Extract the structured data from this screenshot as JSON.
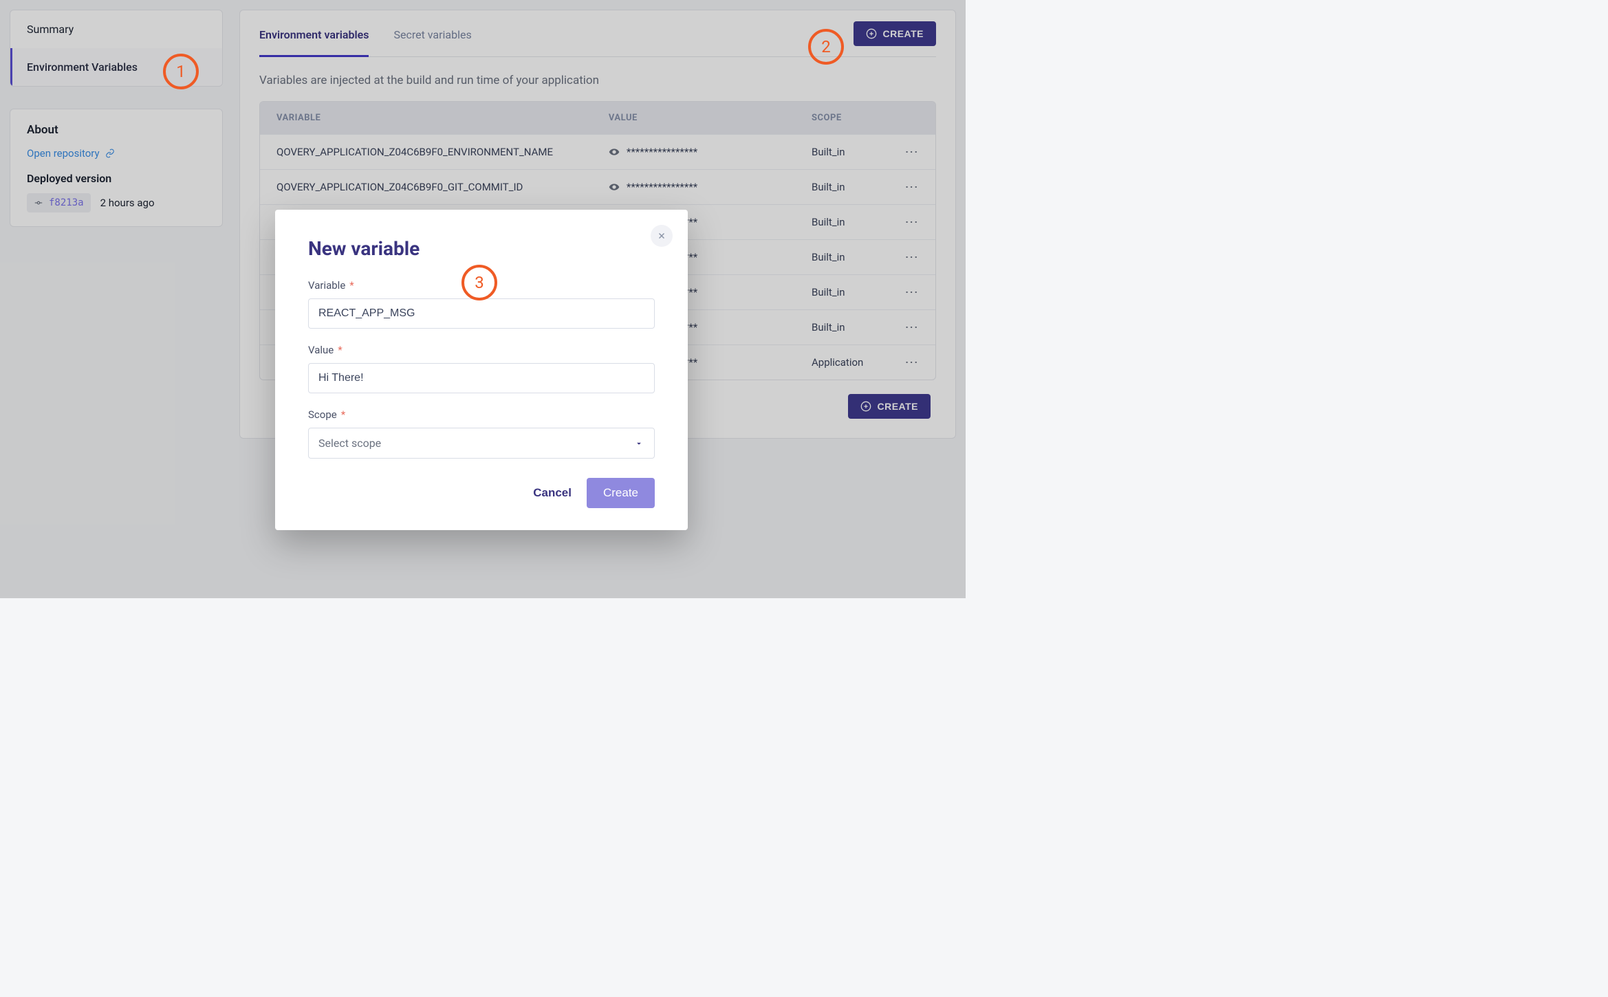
{
  "sidebar": {
    "nav": [
      {
        "label": "Summary"
      },
      {
        "label": "Environment Variables"
      }
    ],
    "about": {
      "title": "About",
      "open_repo": "Open repository",
      "deployed_title": "Deployed version",
      "commit_hash": "f8213a",
      "commit_ago": "2 hours ago"
    }
  },
  "main": {
    "tabs": [
      {
        "label": "Environment variables"
      },
      {
        "label": "Secret variables"
      }
    ],
    "create_label": "CREATE",
    "description": "Variables are injected at the build and run time of your application",
    "columns": {
      "variable": "VARIABLE",
      "value": "VALUE",
      "scope": "SCOPE"
    },
    "masked_value": "****************",
    "rows": [
      {
        "name": "QOVERY_APPLICATION_Z04C6B9F0_ENVIRONMENT_NAME",
        "scope": "Built_in"
      },
      {
        "name": "QOVERY_APPLICATION_Z04C6B9F0_GIT_COMMIT_ID",
        "scope": "Built_in"
      },
      {
        "name": "",
        "scope": "Built_in"
      },
      {
        "name": "",
        "scope": "Built_in"
      },
      {
        "name": "",
        "scope": "Built_in"
      },
      {
        "name": "",
        "scope": "Built_in"
      },
      {
        "name": "",
        "scope": "Application"
      }
    ],
    "footer_create_label": "CREATE"
  },
  "modal": {
    "title": "New variable",
    "variable_label": "Variable",
    "variable_value": "REACT_APP_MSG",
    "value_label": "Value",
    "value_value": "Hi There!",
    "scope_label": "Scope",
    "scope_placeholder": "Select scope",
    "cancel": "Cancel",
    "create": "Create"
  },
  "annotations": {
    "a1": "1",
    "a2": "2",
    "a3": "3"
  }
}
